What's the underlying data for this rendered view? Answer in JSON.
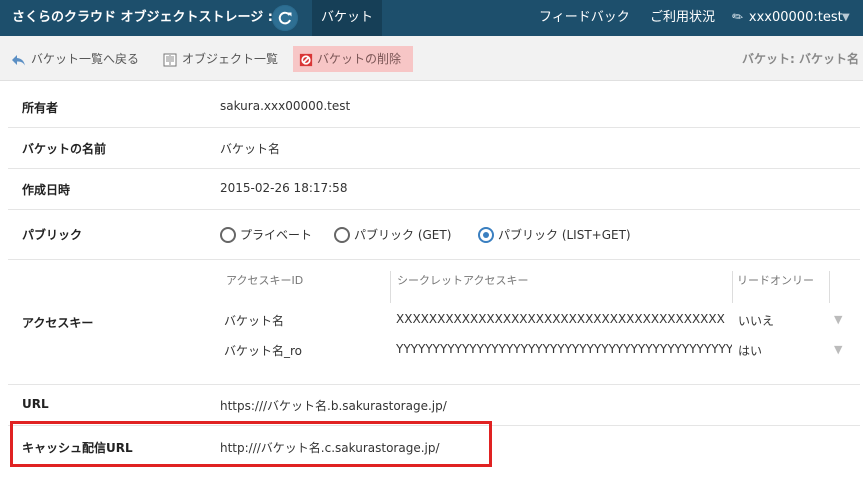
{
  "header": {
    "brand": "さくらのクラウド オブジェクトストレージ :",
    "active_tab": "バケット",
    "feedback": "フィードバック",
    "usage": "ご利用状況",
    "user": "xxx00000:test"
  },
  "toolbar": {
    "back": "バケット一覧へ戻る",
    "objects": "オブジェクト一覧",
    "delete": "バケットの削除",
    "title": "バケット: バケット名"
  },
  "details": {
    "owner_label": "所有者",
    "owner": "sakura.xxx00000.test",
    "name_label": "バケットの名前",
    "name": "バケット名",
    "created_label": "作成日時",
    "created": "2015-02-26 18:17:58",
    "public_label": "パブリック",
    "public_options": [
      "プライベート",
      "パブリック (GET)",
      "パブリック (LIST+GET)"
    ],
    "public_selected": "パブリック (LIST+GET)",
    "access_label": "アクセスキー",
    "access_headers": [
      "アクセスキーID",
      "シークレットアクセスキー",
      "リードオンリー"
    ],
    "access_rows": [
      [
        "バケット名",
        "XXXXXXXXXXXXXXXXXXXXXXXXXXXXXXXXXXXXXXXX",
        "いいえ"
      ],
      [
        "バケット名_ro",
        "YYYYYYYYYYYYYYYYYYYYYYYYYYYYYYYYYYYYYYYYYYYYYY",
        "はい"
      ]
    ],
    "url_label": "URL",
    "url": "https:///バケット名.b.sakurastorage.jp/",
    "cache_label": "キャッシュ配信URL",
    "cache_url": "http:///バケット名.c.sakurastorage.jp/"
  },
  "colors": {
    "header": "#1d4f6c",
    "highlight": "#e02222",
    "delete_bg": "#f7c6c6"
  }
}
